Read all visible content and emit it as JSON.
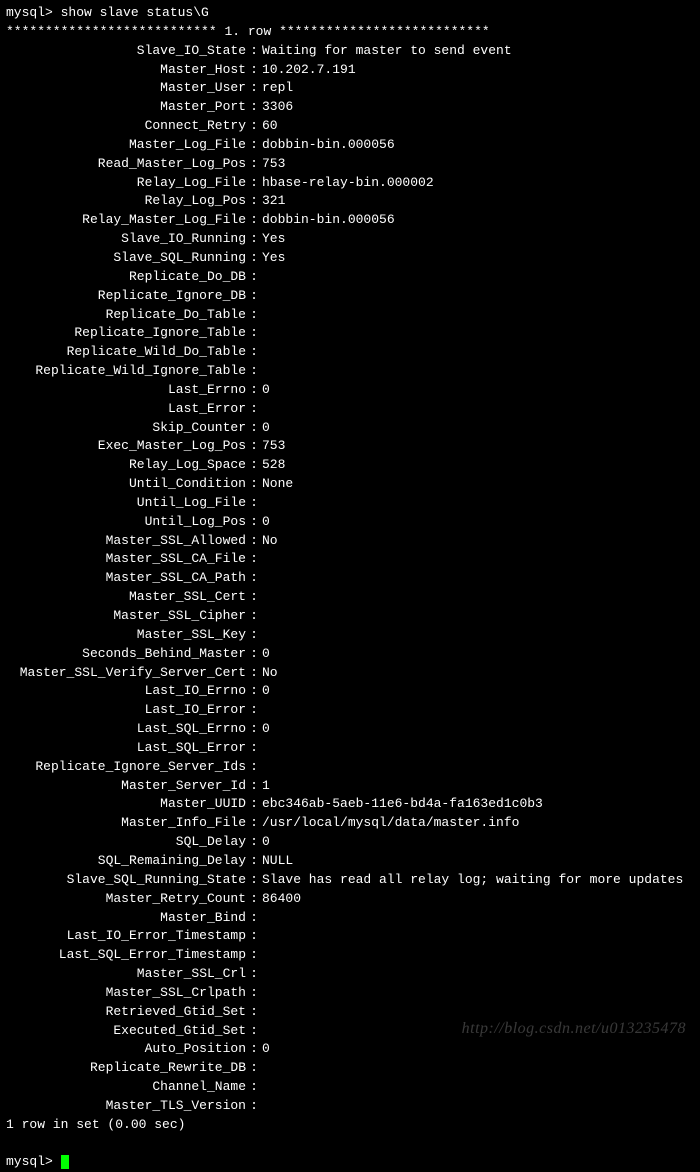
{
  "prompt1": "mysql> ",
  "command": "show slave status\\G",
  "row_header_prefix": "*************************** ",
  "row_header_num": "1.",
  "row_header_label": " row ",
  "row_header_suffix": "***************************",
  "fields": [
    {
      "label": "Slave_IO_State",
      "value": "Waiting for master to send event"
    },
    {
      "label": "Master_Host",
      "value": "10.202.7.191"
    },
    {
      "label": "Master_User",
      "value": "repl"
    },
    {
      "label": "Master_Port",
      "value": "3306"
    },
    {
      "label": "Connect_Retry",
      "value": "60"
    },
    {
      "label": "Master_Log_File",
      "value": "dobbin-bin.000056"
    },
    {
      "label": "Read_Master_Log_Pos",
      "value": "753"
    },
    {
      "label": "Relay_Log_File",
      "value": "hbase-relay-bin.000002"
    },
    {
      "label": "Relay_Log_Pos",
      "value": "321"
    },
    {
      "label": "Relay_Master_Log_File",
      "value": "dobbin-bin.000056"
    },
    {
      "label": "Slave_IO_Running",
      "value": "Yes"
    },
    {
      "label": "Slave_SQL_Running",
      "value": "Yes"
    },
    {
      "label": "Replicate_Do_DB",
      "value": ""
    },
    {
      "label": "Replicate_Ignore_DB",
      "value": ""
    },
    {
      "label": "Replicate_Do_Table",
      "value": ""
    },
    {
      "label": "Replicate_Ignore_Table",
      "value": ""
    },
    {
      "label": "Replicate_Wild_Do_Table",
      "value": ""
    },
    {
      "label": "Replicate_Wild_Ignore_Table",
      "value": ""
    },
    {
      "label": "Last_Errno",
      "value": "0"
    },
    {
      "label": "Last_Error",
      "value": ""
    },
    {
      "label": "Skip_Counter",
      "value": "0"
    },
    {
      "label": "Exec_Master_Log_Pos",
      "value": "753"
    },
    {
      "label": "Relay_Log_Space",
      "value": "528"
    },
    {
      "label": "Until_Condition",
      "value": "None"
    },
    {
      "label": "Until_Log_File",
      "value": ""
    },
    {
      "label": "Until_Log_Pos",
      "value": "0"
    },
    {
      "label": "Master_SSL_Allowed",
      "value": "No"
    },
    {
      "label": "Master_SSL_CA_File",
      "value": ""
    },
    {
      "label": "Master_SSL_CA_Path",
      "value": ""
    },
    {
      "label": "Master_SSL_Cert",
      "value": ""
    },
    {
      "label": "Master_SSL_Cipher",
      "value": ""
    },
    {
      "label": "Master_SSL_Key",
      "value": ""
    },
    {
      "label": "Seconds_Behind_Master",
      "value": "0"
    },
    {
      "label": "Master_SSL_Verify_Server_Cert",
      "value": "No"
    },
    {
      "label": "Last_IO_Errno",
      "value": "0"
    },
    {
      "label": "Last_IO_Error",
      "value": ""
    },
    {
      "label": "Last_SQL_Errno",
      "value": "0"
    },
    {
      "label": "Last_SQL_Error",
      "value": ""
    },
    {
      "label": "Replicate_Ignore_Server_Ids",
      "value": ""
    },
    {
      "label": "Master_Server_Id",
      "value": "1"
    },
    {
      "label": "Master_UUID",
      "value": "ebc346ab-5aeb-11e6-bd4a-fa163ed1c0b3"
    },
    {
      "label": "Master_Info_File",
      "value": "/usr/local/mysql/data/master.info"
    },
    {
      "label": "SQL_Delay",
      "value": "0"
    },
    {
      "label": "SQL_Remaining_Delay",
      "value": "NULL"
    },
    {
      "label": "Slave_SQL_Running_State",
      "value": "Slave has read all relay log; waiting for more updates"
    },
    {
      "label": "Master_Retry_Count",
      "value": "86400"
    },
    {
      "label": "Master_Bind",
      "value": ""
    },
    {
      "label": "Last_IO_Error_Timestamp",
      "value": ""
    },
    {
      "label": "Last_SQL_Error_Timestamp",
      "value": ""
    },
    {
      "label": "Master_SSL_Crl",
      "value": ""
    },
    {
      "label": "Master_SSL_Crlpath",
      "value": ""
    },
    {
      "label": "Retrieved_Gtid_Set",
      "value": ""
    },
    {
      "label": "Executed_Gtid_Set",
      "value": ""
    },
    {
      "label": "Auto_Position",
      "value": "0"
    },
    {
      "label": "Replicate_Rewrite_DB",
      "value": ""
    },
    {
      "label": "Channel_Name",
      "value": ""
    },
    {
      "label": "Master_TLS_Version",
      "value": ""
    }
  ],
  "footer": "1 row in set (0.00 sec)",
  "prompt2": "mysql> ",
  "watermark": "http://blog.csdn.net/u013235478"
}
